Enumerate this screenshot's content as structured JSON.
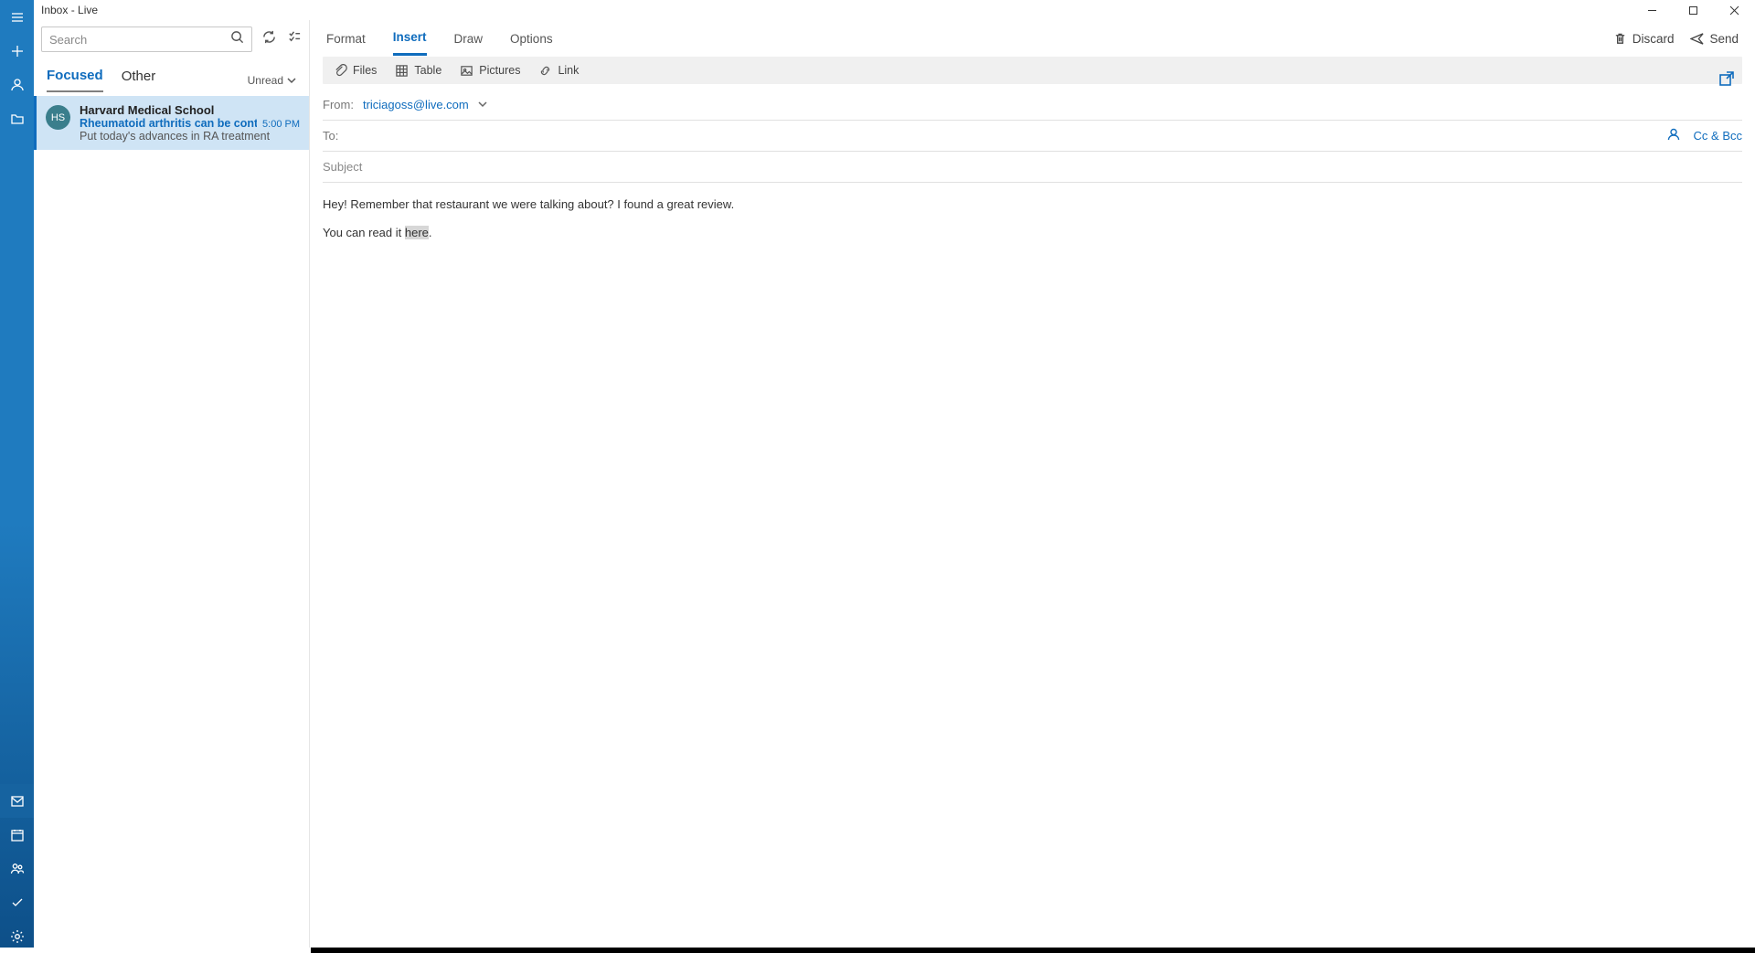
{
  "window": {
    "title": "Inbox - Live"
  },
  "search": {
    "placeholder": "Search"
  },
  "list_tabs": {
    "focused": "Focused",
    "other": "Other",
    "filter": "Unread"
  },
  "message": {
    "avatar_initials": "HS",
    "sender": "Harvard Medical School",
    "subject": "Rheumatoid arthritis can be controlle",
    "time": "5:00 PM",
    "preview": "Put today's advances in RA treatment"
  },
  "ribbon": {
    "tabs": {
      "format": "Format",
      "insert": "Insert",
      "draw": "Draw",
      "options": "Options"
    },
    "actions": {
      "discard": "Discard",
      "send": "Send"
    },
    "cmds": {
      "files": "Files",
      "table": "Table",
      "pictures": "Pictures",
      "link": "Link"
    }
  },
  "compose": {
    "from_label": "From:",
    "from_value": "triciagoss@live.com",
    "to_label": "To:",
    "cc_bcc": "Cc & Bcc",
    "subject_placeholder": "Subject",
    "body_line1": "Hey! Remember that restaurant we were talking about? I found a great review.",
    "body_line2_a": "You can read it ",
    "body_line2_sel": "here",
    "body_line2_b": "."
  }
}
